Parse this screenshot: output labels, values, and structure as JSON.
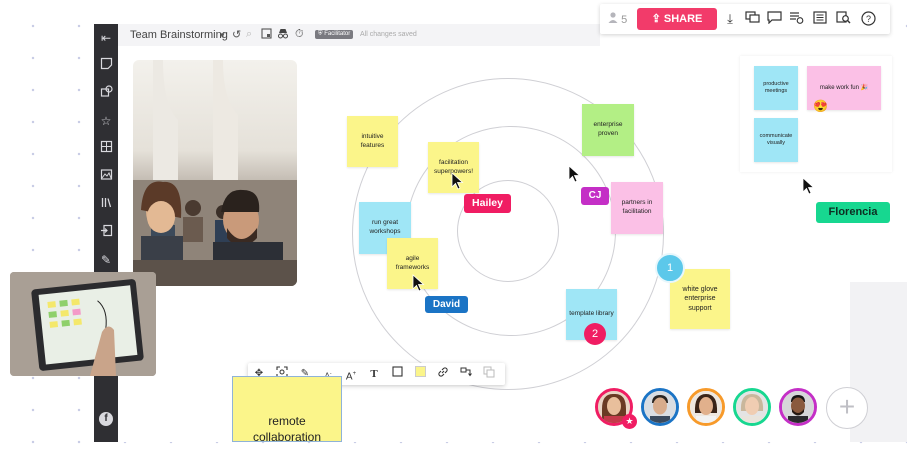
{
  "header": {
    "board_title": "Team Brainstorming",
    "facilitator_badge": "Facilitator",
    "saved_status": "All changes saved",
    "users_count": "5",
    "share_label": "SHARE"
  },
  "notes": {
    "intuitive": "intuitive features",
    "facilitation": "facilitation superpowers!",
    "enterprise": "enterprise proven",
    "workshops": "run great workshops",
    "agile": "agile frameworks",
    "partners": "partners in facilitation",
    "template": "template library",
    "whiteglove": "white glove enterprise support",
    "remote": "remote collaboration"
  },
  "mini_board": {
    "productive": "productive meetings",
    "fun": "make work fun 🎉",
    "visually": "communicate visually",
    "emoji": "😍"
  },
  "cursors": {
    "hailey": "Hailey",
    "cj": "CJ",
    "david": "David",
    "florencia": "Florencia"
  },
  "badges": {
    "one": "1",
    "two": "2"
  },
  "left_toolbar": {
    "footer_icon": "f"
  },
  "avatars_add": "+",
  "colors": {
    "share": "#f23b6a",
    "hailey": "#f01d63",
    "cj": "#c42fc6",
    "david": "#1b74c5",
    "florencia": "#17d790",
    "note_yellow": "#fbf58a",
    "note_cyan": "#9fe6f6",
    "note_green": "#b3ef85",
    "note_pink": "#fbc0e6"
  }
}
